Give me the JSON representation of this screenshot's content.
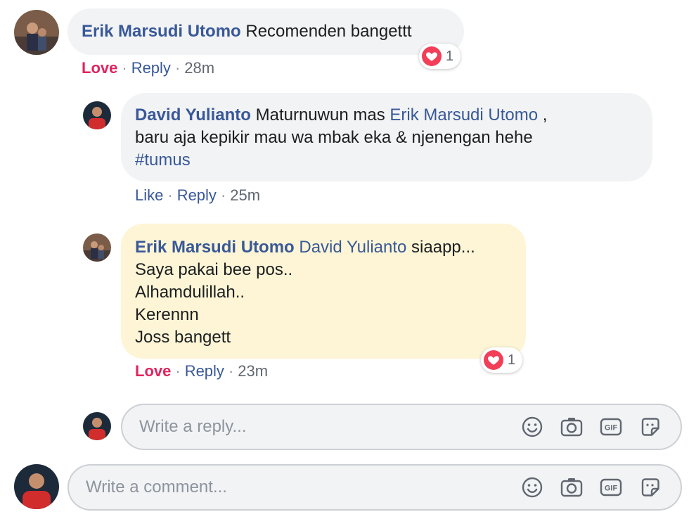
{
  "comment1": {
    "author": "Erik Marsudi Utomo",
    "text": "Recomenden bangettt",
    "reaction_count": "1",
    "actions": {
      "love": "Love",
      "reply": "Reply",
      "time": "28m",
      "sep": "·"
    }
  },
  "reply1": {
    "author": "David Yulianto",
    "text_before": "Maturnuwun mas",
    "mention": "Erik Marsudi Utomo",
    "text_after_mention": ",",
    "line2": "baru aja kepikir mau wa mbak eka & njenengan hehe",
    "hashtag": "#tumus",
    "actions": {
      "like": "Like",
      "reply": "Reply",
      "time": "25m",
      "sep": "·"
    }
  },
  "reply2": {
    "author": "Erik Marsudi Utomo",
    "mention": "David Yulianto",
    "text_first": "siaapp...",
    "lines": [
      "Saya pakai bee pos..",
      "Alhamdulillah..",
      "Kerennn",
      "Joss bangett"
    ],
    "reaction_count": "1",
    "actions": {
      "love": "Love",
      "reply": "Reply",
      "time": "23m",
      "sep": "·"
    }
  },
  "reply_composer": {
    "placeholder": "Write a reply..."
  },
  "comment_composer": {
    "placeholder": "Write a comment..."
  },
  "icons": {
    "emoji": "emoji-icon",
    "camera": "camera-icon",
    "gif": "gif-icon",
    "sticker": "sticker-icon",
    "heart": "heart-icon"
  },
  "colors": {
    "link": "#385898",
    "love": "#e0245e",
    "bubble_grey": "#f2f3f5",
    "bubble_highlight": "#fdf5d5",
    "heart": "#f33e58"
  }
}
